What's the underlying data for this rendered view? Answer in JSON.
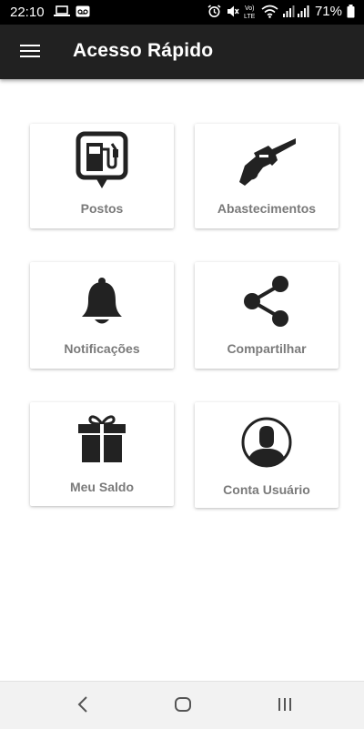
{
  "status_bar": {
    "time": "22:10",
    "battery": "71%",
    "icons": [
      "laptop-icon",
      "voicemail-icon",
      "alarm-icon",
      "mute-icon",
      "volte-icon",
      "wifi-icon",
      "signal-icon",
      "battery-icon"
    ]
  },
  "app_bar": {
    "title": "Acesso Rápido",
    "menu_icon": "hamburger-menu-icon",
    "background": "#212121"
  },
  "cards": [
    {
      "label": "Postos",
      "icon": "gas-station-icon"
    },
    {
      "label": "Abastecimentos",
      "icon": "fuel-nozzle-icon"
    },
    {
      "label": "Notificações",
      "icon": "bell-icon"
    },
    {
      "label": "Compartilhar",
      "icon": "share-icon"
    },
    {
      "label": "Meu Saldo",
      "icon": "gift-icon"
    },
    {
      "label": "Conta Usuário",
      "icon": "user-account-icon"
    }
  ],
  "nav_bar": {
    "buttons": [
      "back-icon",
      "home-icon",
      "recents-icon"
    ]
  },
  "colors": {
    "label_gray": "#7a7a7a",
    "icon_dark": "#222222"
  }
}
